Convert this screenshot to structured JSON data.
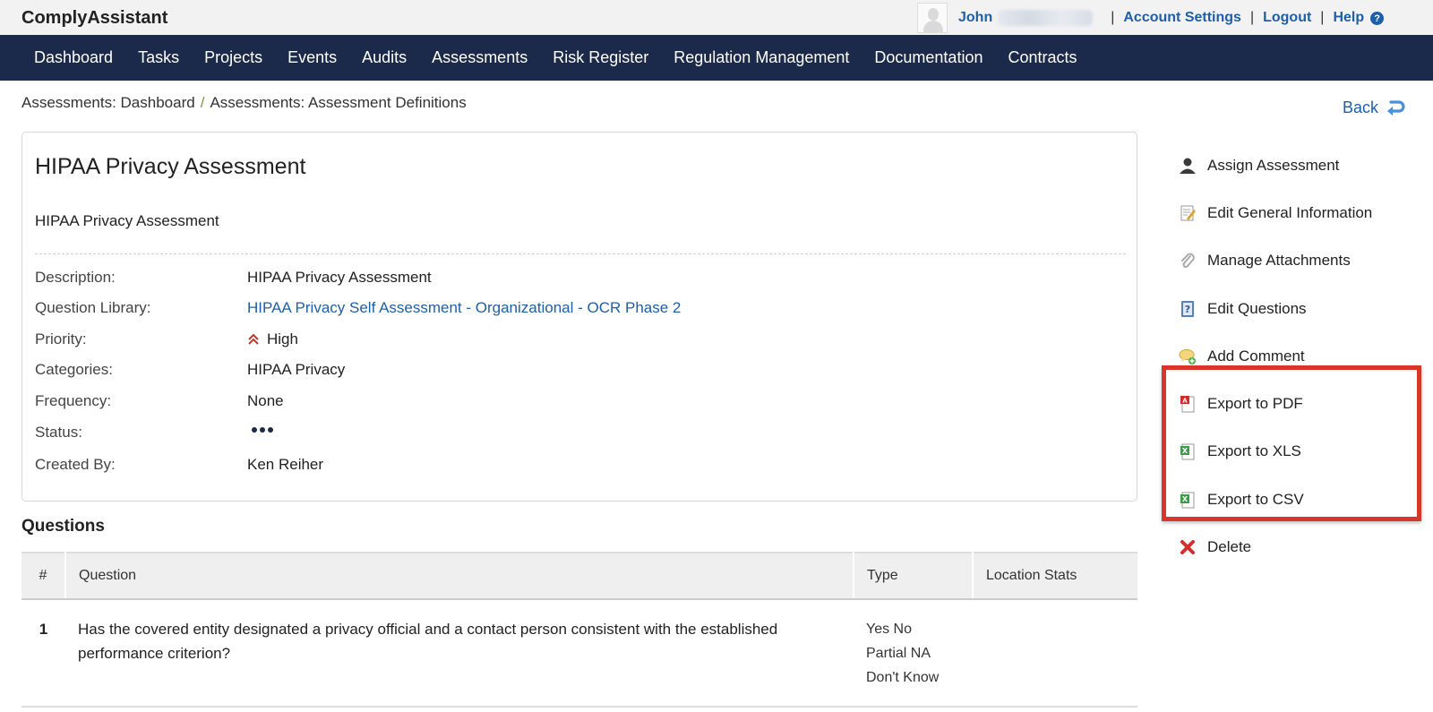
{
  "app": {
    "brand": "ComplyAssistant"
  },
  "topbar": {
    "user_name": "John",
    "account_settings": "Account Settings",
    "logout": "Logout",
    "help": "Help",
    "separator": "|"
  },
  "nav": {
    "items": [
      "Dashboard",
      "Tasks",
      "Projects",
      "Events",
      "Audits",
      "Assessments",
      "Risk Register",
      "Regulation Management",
      "Documentation",
      "Contracts"
    ]
  },
  "breadcrumb": {
    "items": [
      "Assessments: Dashboard",
      "Assessments: Assessment Definitions"
    ],
    "separator": "/"
  },
  "back_label": "Back",
  "detail": {
    "title": "HIPAA Privacy Assessment",
    "subtitle": "HIPAA Privacy Assessment",
    "fields": {
      "description": {
        "label": "Description:",
        "value": "HIPAA Privacy Assessment"
      },
      "question_library": {
        "label": "Question Library:",
        "value": "HIPAA Privacy Self Assessment - Organizational - OCR Phase 2"
      },
      "priority": {
        "label": "Priority:",
        "value": "High"
      },
      "categories": {
        "label": "Categories:",
        "value": "HIPAA Privacy"
      },
      "frequency": {
        "label": "Frequency:",
        "value": "None"
      },
      "status": {
        "label": "Status:"
      },
      "created_by": {
        "label": "Created By:",
        "value": "Ken Reiher"
      }
    }
  },
  "questions": {
    "heading": "Questions",
    "columns": [
      "#",
      "Question",
      "Type",
      "Location Stats"
    ],
    "rows": [
      {
        "num": "1",
        "question": "Has the covered entity designated a privacy official and a contact person consistent with the established performance criterion?",
        "type_lines": [
          "Yes No",
          "Partial NA",
          "Don't Know"
        ],
        "location_stats": ""
      }
    ]
  },
  "actions": {
    "items": [
      {
        "label": "Assign Assessment",
        "icon": "user-icon"
      },
      {
        "label": "Edit General Information",
        "icon": "edit-document-icon"
      },
      {
        "label": "Manage Attachments",
        "icon": "paperclip-icon"
      },
      {
        "label": "Edit Questions",
        "icon": "question-book-icon"
      },
      {
        "label": "Add Comment",
        "icon": "comment-add-icon"
      },
      {
        "label": "Export to PDF",
        "icon": "pdf-icon"
      },
      {
        "label": "Export to XLS",
        "icon": "excel-icon"
      },
      {
        "label": "Export to CSV",
        "icon": "csv-icon"
      },
      {
        "label": "Delete",
        "icon": "delete-icon"
      }
    ]
  },
  "colors": {
    "nav_bg": "#1b2a4a",
    "link": "#1f5fa8",
    "highlight": "#d8362a",
    "priority_high": "#c0392b"
  }
}
